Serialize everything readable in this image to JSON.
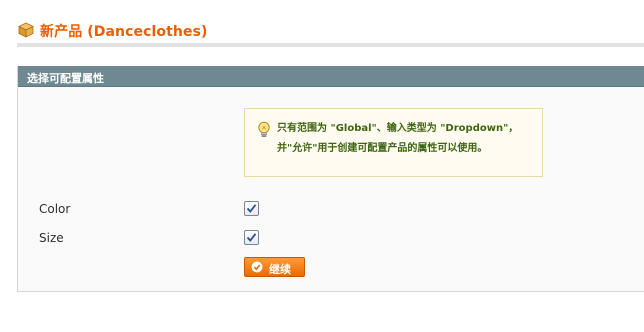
{
  "header": {
    "title": "新产品 (Danceclothes)",
    "icon": "product-box-icon"
  },
  "panel": {
    "title": "选择可配置属性",
    "notice": {
      "icon": "lightbulb-icon",
      "text": "只有范围为 \"Global\"、输入类型为 \"Dropdown\"，并\"允许\"用于创建可配置产品的属性可以使用。"
    },
    "attributes": [
      {
        "label": "Color",
        "checked": true
      },
      {
        "label": "Size",
        "checked": true
      }
    ],
    "continue_button": {
      "label": "继续",
      "icon": "arrow-right-circle-icon"
    }
  },
  "colors": {
    "title": "#eb5e00",
    "panel_header": "#6f8992",
    "notice_text": "#3d6611",
    "button": "#f07800"
  }
}
